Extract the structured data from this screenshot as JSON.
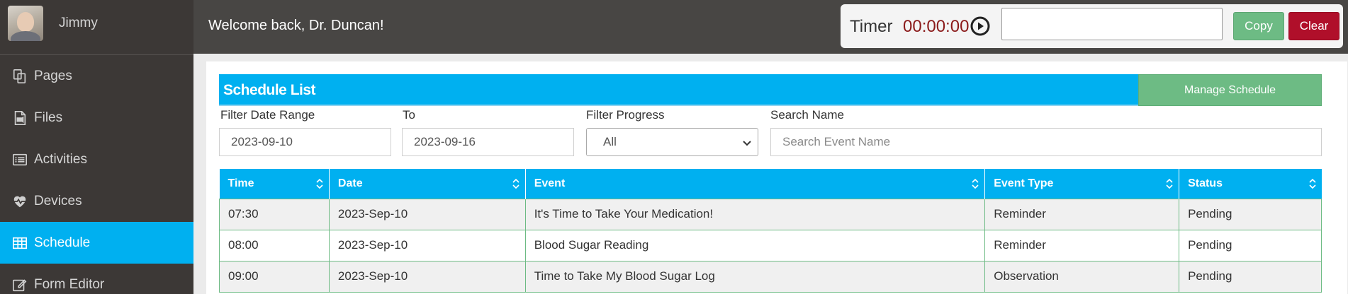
{
  "user": {
    "name": "Jimmy"
  },
  "sidebar": {
    "items": [
      {
        "label": "Pages",
        "icon": "pages-icon",
        "active": false
      },
      {
        "label": "Files",
        "icon": "file-video-icon",
        "active": false
      },
      {
        "label": "Activities",
        "icon": "list-icon",
        "active": false
      },
      {
        "label": "Devices",
        "icon": "heartbeat-icon",
        "active": false
      },
      {
        "label": "Schedule",
        "icon": "table-icon",
        "active": true
      },
      {
        "label": "Form Editor",
        "icon": "edit-icon",
        "active": false
      }
    ]
  },
  "header": {
    "welcome": "Welcome back, Dr. Duncan!",
    "timer_label": "Timer",
    "timer_value": "00:00:00",
    "timer_input_value": "",
    "copy_label": "Copy",
    "clear_label": "Clear"
  },
  "schedule": {
    "title": "Schedule List",
    "manage_label": "Manage Schedule",
    "filters": {
      "date_range_label": "Filter Date Range",
      "from_value": "2023-09-10",
      "to_label": "To",
      "to_value": "2023-09-16",
      "progress_label": "Filter Progress",
      "progress_value": "All",
      "search_label": "Search Name",
      "search_placeholder": "Search Event Name"
    },
    "columns": [
      "Time",
      "Date",
      "Event",
      "Event Type",
      "Status"
    ],
    "rows": [
      [
        "07:30",
        "2023-Sep-10",
        "It's Time to Take Your Medication!",
        "Reminder",
        "Pending"
      ],
      [
        "08:00",
        "2023-Sep-10",
        "Blood Sugar Reading",
        "Reminder",
        "Pending"
      ],
      [
        "09:00",
        "2023-Sep-10",
        "Time to Take My Blood Sugar Log",
        "Observation",
        "Pending"
      ]
    ]
  },
  "colors": {
    "accent": "#00b0f0",
    "sidebar_bg": "#3c3836",
    "header_bg": "#484644",
    "copy_green": "#6dbb84",
    "clear_red": "#b00f2a",
    "timer_red": "#8b1a1a"
  }
}
